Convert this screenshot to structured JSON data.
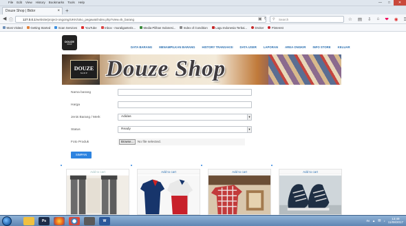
{
  "browser": {
    "menu": [
      "File",
      "Edit",
      "View",
      "History",
      "Bookmarks",
      "Tools",
      "Help"
    ],
    "tab_title": "Douze Shop | Bidor",
    "url_domain": "127.0.0.1",
    "url_rest": "/website/project-ongoing/UKK/toko_pegawai/index.php?view=tk_barang",
    "search_placeholder": "Search",
    "bookmarks": [
      {
        "label": "Most Visited",
        "color": "#6d8fb8"
      },
      {
        "label": "Getting Started",
        "color": "#e0813a"
      },
      {
        "label": "Scan Services",
        "color": "#3a8fe0"
      },
      {
        "label": "YouTube",
        "color": "#e02b2b"
      },
      {
        "label": "Inbox - muraliganteris...",
        "color": "#d44"
      },
      {
        "label": "Media Pilihan Indonesi...",
        "color": "#3a8a3a"
      },
      {
        "label": "Index of /condition",
        "color": "#888"
      },
      {
        "label": "Lagu Indonesia Terbai...",
        "color": "#c62828"
      },
      {
        "label": "Droker",
        "color": "#c62828"
      },
      {
        "label": "Pinterest",
        "color": "#c8232c"
      }
    ]
  },
  "site": {
    "logo_text": "DOUZE",
    "logo_sub": "SHOP",
    "nav": [
      "DATA BARANG",
      "MENAMPILKAN BARANG",
      "HISTORY TRANSAKSI",
      "DATA USER",
      "LAPORAN",
      "AREA ONGKIR",
      "INFO STORE",
      "KELUAR"
    ],
    "banner_title": "Douze Shop",
    "banner_logo": "DOUZE",
    "banner_logo_sub": "SHOP"
  },
  "form": {
    "fields": [
      {
        "label": "Nama barang",
        "value": ""
      },
      {
        "label": "Harga",
        "value": ""
      },
      {
        "label": "Jenis Barang / Merk",
        "value": "Adidas"
      },
      {
        "label": "Status",
        "value": "Ready"
      },
      {
        "label": "Foto Produk",
        "browse": "Browse...",
        "file_status": "No file selected."
      }
    ],
    "submit_label": "SIMPAN"
  },
  "products": [
    {
      "action": "Add to cart"
    },
    {
      "action": "Add to cart"
    },
    {
      "action": "Add to cart"
    },
    {
      "action": "Add to cart"
    }
  ],
  "taskbar": {
    "time": "13:49",
    "date": "11/08/2017"
  }
}
